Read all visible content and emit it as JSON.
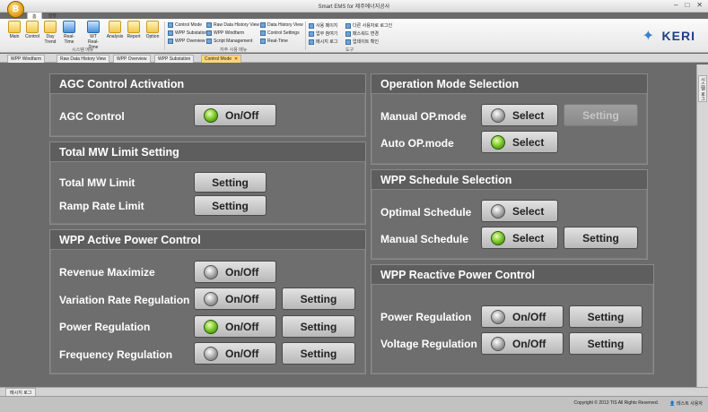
{
  "window": {
    "title": "Smart EMS for 제주에너지공사",
    "orb_label": "B",
    "menu_tabs": [
      "홈",
      "설정"
    ],
    "controls": [
      "–",
      "□",
      "✕"
    ]
  },
  "ribbon": {
    "buttons": [
      {
        "label": "Main",
        "icon": "home-icon"
      },
      {
        "label": "Control",
        "icon": "control-icon"
      },
      {
        "label": "Day Trend",
        "icon": "trend-icon"
      },
      {
        "label": "Real-Time",
        "icon": "realtime-icon"
      },
      {
        "label": "WT Real-Time",
        "icon": "wind-turbine-icon"
      },
      {
        "label": "Analysis",
        "icon": "analysis-icon"
      },
      {
        "label": "Report",
        "icon": "report-icon"
      },
      {
        "label": "Option",
        "icon": "option-icon"
      }
    ],
    "group1_label": "시스템 메뉴",
    "small_col1": [
      "Control Mode",
      "WPP Substation",
      "WPP Overview"
    ],
    "small_col2": [
      "Raw Data History View",
      "WPP Windfarm",
      "Script Management"
    ],
    "small_col3": [
      "Data History View",
      "Control Settings",
      "Real-Time"
    ],
    "group2_label": "자주 사용 메뉴",
    "small_col4": [
      "사용 페이지",
      "업무 참여기",
      "메시지 로그"
    ],
    "small_col5": [
      "다른 사용자로 로그인",
      "패스워드 변경",
      "업데이트 확인"
    ],
    "group3_label": "도구",
    "logo": "KERI"
  },
  "doc_tabs": [
    "WPP Windfarm",
    "Raw Data History View",
    "WPP Overview",
    "WPP Substation",
    "Control Mode"
  ],
  "side_tab": "시스템 로그",
  "panels": {
    "agc": {
      "title": "AGC Control Activation",
      "row_label": "AGC Control",
      "btn": "On/Off",
      "state": "on"
    },
    "mw": {
      "title": "Total MW Limit Setting",
      "rows": [
        {
          "label": "Total MW Limit",
          "btn": "Setting"
        },
        {
          "label": "Ramp Rate Limit",
          "btn": "Setting"
        }
      ]
    },
    "wpp_active": {
      "title": "WPP Active Power Control",
      "rows": [
        {
          "label": "Revenue Maximize",
          "toggle": "On/Off",
          "state": "off",
          "setting": ""
        },
        {
          "label": "Variation Rate Regulation",
          "toggle": "On/Off",
          "state": "off",
          "setting": "Setting"
        },
        {
          "label": "Power Regulation",
          "toggle": "On/Off",
          "state": "on",
          "setting": "Setting"
        },
        {
          "label": "Frequency Regulation",
          "toggle": "On/Off",
          "state": "off",
          "setting": "Setting"
        }
      ]
    },
    "op_mode": {
      "title": "Operation Mode Selection",
      "rows": [
        {
          "label": "Manual OP.mode",
          "select": "Select",
          "state": "off",
          "setting": "Setting"
        },
        {
          "label": "Auto OP.mode",
          "select": "Select",
          "state": "on"
        }
      ]
    },
    "schedule": {
      "title": "WPP Schedule Selection",
      "rows": [
        {
          "label": "Optimal Schedule",
          "select": "Select",
          "state": "off"
        },
        {
          "label": "Manual Schedule",
          "select": "Select",
          "state": "on",
          "setting": "Setting"
        }
      ]
    },
    "reactive": {
      "title": "WPP Reactive Power Control",
      "rows": [
        {
          "label": "Power Regulation",
          "toggle": "On/Off",
          "state": "off",
          "setting": "Setting"
        },
        {
          "label": "Voltage Regulation",
          "toggle": "On/Off",
          "state": "off",
          "setting": "Setting"
        }
      ]
    }
  },
  "status": {
    "message_tab": "메시지 로그",
    "copyright": "Copyright © 2013 TIS All Rights Reserved.",
    "user": "테스트 사용자"
  },
  "colors": {
    "background": "#6b6b6b",
    "panel_header": "#5e5e5e",
    "led_on": "#6fbf1e",
    "led_off": "#9a9a9a",
    "active_tab": "#fcd77a",
    "logo": "#1f3f88"
  }
}
